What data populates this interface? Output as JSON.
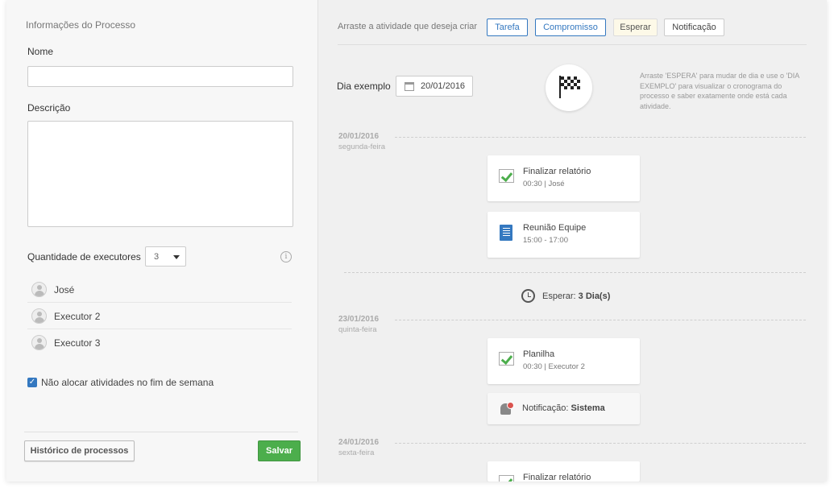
{
  "left": {
    "section_title": "Informações do Processo",
    "nome_label": "Nome",
    "nome_value": "",
    "descricao_label": "Descrição",
    "descricao_value": "",
    "qtd_label": "Quantidade de executores",
    "qtd_value": "3",
    "info_icon": "i",
    "executores": [
      "José",
      "Executor 2",
      "Executor 3"
    ],
    "weekend_checked": true,
    "weekend_label": "Não alocar atividades no fim de semana",
    "historico_button": "Histórico de processos",
    "salvar_button": "Salvar"
  },
  "right": {
    "drag_text": "Arraste a atividade que deseja criar",
    "activity_buttons": [
      "Tarefa",
      "Compromisso",
      "Esperar",
      "Notificação"
    ],
    "dia_label": "Dia exemplo",
    "dia_value": "20/01/2016",
    "hint": "Arraste 'ESPERA' para mudar de dia e use o 'DIA EXEMPLO' para visualizar o cronograma do processo e saber exatamente onde está cada atividade.",
    "days": [
      {
        "date": "20/01/2016",
        "weekday": "segunda-feira"
      },
      {
        "date": "23/01/2016",
        "weekday": "quinta-feira"
      },
      {
        "date": "24/01/2016",
        "weekday": "sexta-feira"
      }
    ],
    "cards": [
      {
        "title": "Finalizar relatório",
        "sub": "00:30 | José",
        "icon": "checkbox-icon"
      },
      {
        "title": "Reunião Equipe",
        "sub": "15:00 - 17:00",
        "icon": "notebook-icon"
      },
      {
        "title": "Planilha",
        "sub": "00:30 | Executor 2",
        "icon": "checkbox-icon"
      }
    ],
    "wait_prefix": "Esperar:",
    "wait_value": "3 Dia(s)",
    "notification_prefix": "Notificação:",
    "notification_value": "Sistema",
    "partial_card_title": "Finalizar relatório"
  },
  "colors": {
    "primary": "#3478c0",
    "success": "#4cae4c",
    "panel": "#f7f7f7",
    "timeline": "#f0f0f0"
  }
}
